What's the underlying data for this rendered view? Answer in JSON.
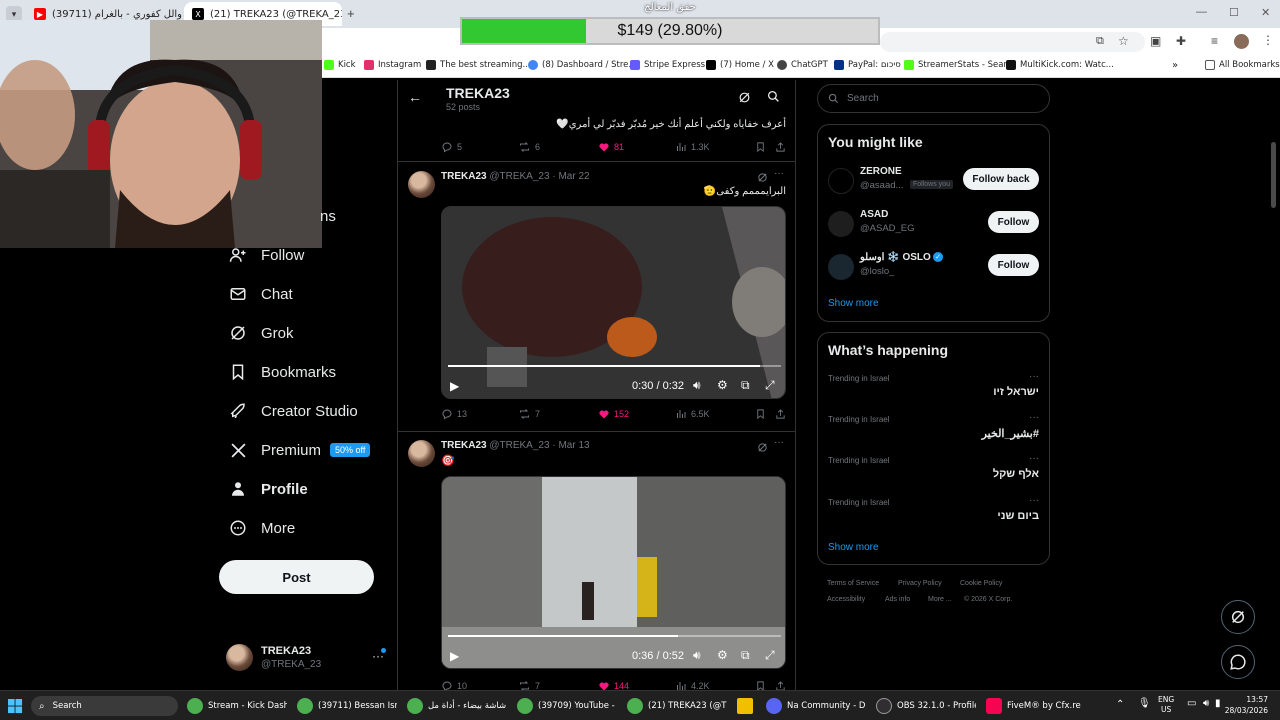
{
  "browser": {
    "tabs": [
      {
        "label": "(39711) والل كفوري - بالغرام ...",
        "active": false
      },
      {
        "label": "(21) TREKA23 (@TREKA_23) / X",
        "active": true
      }
    ],
    "new_tab": "+",
    "bookmarks": [
      {
        "label": "Kick",
        "color": "#53fc18"
      },
      {
        "label": "Instagram",
        "color": "#e1306c"
      },
      {
        "label": "The best streaming...",
        "color": "#222222"
      },
      {
        "label": "(8) Dashboard / Stre...",
        "color": "#4285f4"
      },
      {
        "label": "Stripe Express",
        "color": "#635bff"
      },
      {
        "label": "(7) Home / X",
        "color": "#000000"
      },
      {
        "label": "ChatGPT",
        "color": "#444444"
      },
      {
        "label": "PayPal: סיכום",
        "color": "#003087"
      },
      {
        "label": "StreamerStats - Sear...",
        "color": "#53fc18"
      },
      {
        "label": "MultiKick.com: Watc...",
        "color": "#111111"
      }
    ],
    "all_bookmarks": "All Bookmarks"
  },
  "overlay": {
    "title": "حقق المعالج",
    "amount_text": "$149 (29.80%)",
    "progress": 0.298
  },
  "nav": {
    "partial_item": "ns",
    "items": [
      {
        "label": "Follow",
        "icon": "follow-icon"
      },
      {
        "label": "Chat",
        "icon": "chat-icon"
      },
      {
        "label": "Grok",
        "icon": "grok-icon"
      },
      {
        "label": "Bookmarks",
        "icon": "bookmark-icon"
      },
      {
        "label": "Creator Studio",
        "icon": "rocket-icon"
      },
      {
        "label": "Premium",
        "icon": "x-logo-icon",
        "badge": "50% off"
      },
      {
        "label": "Profile",
        "icon": "person-icon"
      },
      {
        "label": "More",
        "icon": "more-circle-icon"
      }
    ],
    "post_button": "Post",
    "account": {
      "name": "TREKA23",
      "handle": "@TREKA_23"
    }
  },
  "profile_header": {
    "name": "TREKA23",
    "posts_count": "52 posts"
  },
  "tweets": [
    {
      "text": "أعرف خفاياه ولكني أعلم أنك خير مُدبّر فدبّر لي أمري🤍",
      "replies": "5",
      "reposts": "6",
      "likes": "81",
      "views": "1.3K"
    },
    {
      "name": "TREKA23",
      "handle": "@TREKA_23",
      "date": "Mar 22",
      "text": "البرايمممم وكفى🫡",
      "video_time": "0:30 / 0:32",
      "video_progress": 0.9375,
      "replies": "13",
      "reposts": "7",
      "likes": "152",
      "views": "6.5K"
    },
    {
      "name": "TREKA23",
      "handle": "@TREKA_23",
      "date": "Mar 13",
      "text": "🎯",
      "video_time": "0:36 / 0:52",
      "video_progress": 0.69,
      "replies": "10",
      "reposts": "7",
      "likes": "144",
      "views": "4.2K"
    }
  ],
  "right": {
    "search_placeholder": "Search",
    "wtf_title": "You might like",
    "wtf": [
      {
        "name": "ZERONE",
        "handle": "@asaad...",
        "follows_you": "Follows you",
        "button": "Follow back"
      },
      {
        "name": "ASAD",
        "handle": "@ASAD_EG",
        "button": "Follow"
      },
      {
        "name": "اوسلو ❄️ OSLO",
        "handle": "@loslo_",
        "button": "Follow"
      }
    ],
    "show_more": "Show more",
    "trends_title": "What’s happening",
    "trends": [
      {
        "context": "Trending in Israel",
        "name": "ישראל זיו"
      },
      {
        "context": "Trending in Israel",
        "name": "#بشير_الخير"
      },
      {
        "context": "Trending in Israel",
        "name": "אלף שקל"
      },
      {
        "context": "Trending in Israel",
        "name": "ביום שני"
      }
    ],
    "trends_show_more": "Show more",
    "footer": [
      "Terms of Service",
      "Privacy Policy",
      "Cookie Policy",
      "Accessibility",
      "Ads info",
      "More ...",
      "© 2026 X Corp."
    ]
  },
  "taskbar": {
    "search": "Search",
    "items": [
      {
        "label": "Stream - Kick Dashbo",
        "color": "#4caf50"
      },
      {
        "label": "(39711) Bessan Ismail",
        "color": "#4caf50"
      },
      {
        "label": "شاشة بيضاء - أداة مل...",
        "color": "#4caf50"
      },
      {
        "label": "(39709) YouTube - Go",
        "color": "#4caf50"
      },
      {
        "label": "(21) TREKA23 (@TREK",
        "color": "#4caf50"
      },
      {
        "label": "",
        "color": "#f0c000"
      },
      {
        "label": "Na Community - D",
        "color": "#5865f2"
      },
      {
        "label": "OBS 32.1.0 - Profile: U",
        "color": "#302e31"
      },
      {
        "label": "FiveM® by Cfx.re",
        "color": "#f40552"
      }
    ],
    "lang": "ENG",
    "region": "US",
    "time": "13:57",
    "date": "28/03/2026"
  }
}
